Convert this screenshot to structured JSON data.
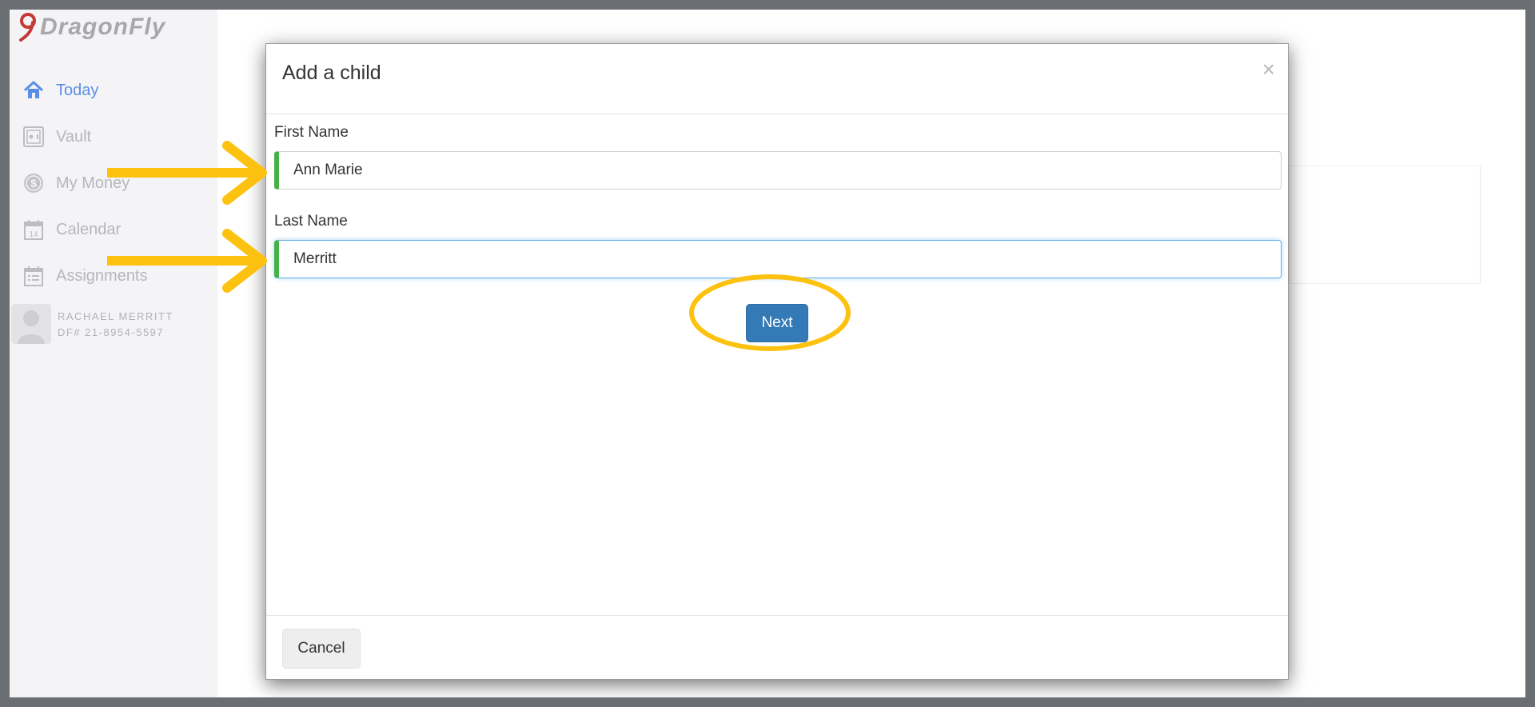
{
  "app": {
    "logo_text": "DragonFly",
    "brand_color": "#c33a36",
    "accent_color": "#5b8ee6"
  },
  "sidebar": {
    "items": [
      {
        "label": "Today",
        "icon": "home-icon",
        "active": true
      },
      {
        "label": "Vault",
        "icon": "vault-icon",
        "active": false
      },
      {
        "label": "My Money",
        "icon": "dollar-icon",
        "active": false
      },
      {
        "label": "Calendar",
        "icon": "calendar-icon",
        "active": false
      },
      {
        "label": "Assignments",
        "icon": "assignments-icon",
        "active": false
      }
    ],
    "user": {
      "name": "RACHAEL MERRITT",
      "id": "DF# 21-8954-5597"
    }
  },
  "modal": {
    "title": "Add a child",
    "close_symbol": "×",
    "first_name": {
      "label": "First Name",
      "value": "Ann Marie"
    },
    "last_name": {
      "label": "Last Name",
      "value": "Merritt"
    },
    "next_label": "Next",
    "cancel_label": "Cancel"
  },
  "annotation_color": "#fdc20f"
}
